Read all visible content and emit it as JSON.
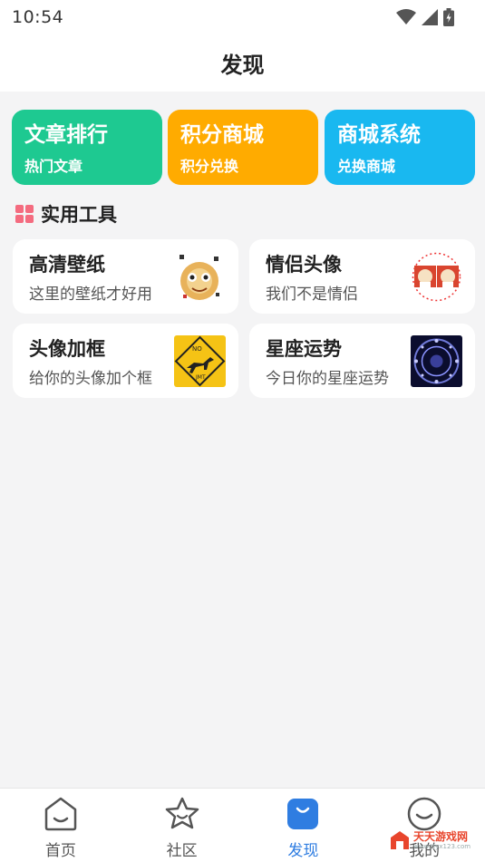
{
  "status_bar": {
    "time": "10:54"
  },
  "header": {
    "title": "发现"
  },
  "quick_cards": [
    {
      "title": "文章排行",
      "subtitle": "热门文章",
      "color": "#1ec991"
    },
    {
      "title": "积分商城",
      "subtitle": "积分兑换",
      "color": "#ffab00"
    },
    {
      "title": "商城系统",
      "subtitle": "兑换商城",
      "color": "#19b8f0"
    }
  ],
  "section": {
    "title": "实用工具",
    "icon": "grid-icon",
    "icon_color": "#f46b7f"
  },
  "tools": [
    {
      "title": "高清壁纸",
      "subtitle": "这里的壁纸才好用",
      "icon": "wallpaper-thumb"
    },
    {
      "title": "情侣头像",
      "subtitle": "我们不是情侣",
      "icon": "couple-avatar-thumb"
    },
    {
      "title": "头像加框",
      "subtitle": "给你的头像加个框",
      "icon": "avatar-frame-thumb"
    },
    {
      "title": "星座运势",
      "subtitle": "今日你的星座运势",
      "icon": "horoscope-thumb"
    }
  ],
  "bottom_nav": [
    {
      "label": "首页",
      "icon": "home-icon"
    },
    {
      "label": "社区",
      "icon": "star-icon"
    },
    {
      "label": "发现",
      "icon": "discover-icon",
      "active": true
    },
    {
      "label": "我的",
      "icon": "profile-icon"
    }
  ],
  "watermark": {
    "text": "天天游戏网",
    "sub": "www.ttyx123.com"
  },
  "colors": {
    "accent": "#2f7de1",
    "background": "#f4f4f5"
  }
}
